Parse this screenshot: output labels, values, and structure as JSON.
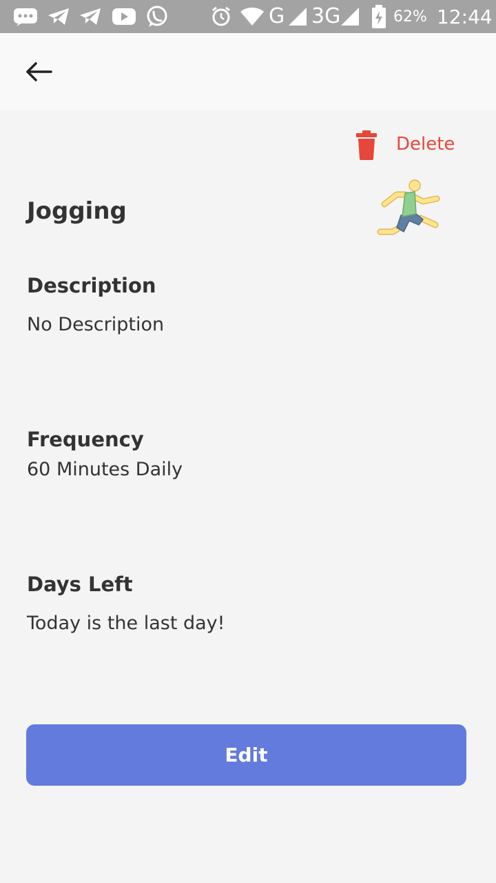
{
  "status_bar": {
    "signal_label": "G",
    "network_label": "3G",
    "battery": "62%",
    "time": "12:44",
    "icons": [
      "message-icon",
      "telegram-icon",
      "telegram-icon",
      "youtube-icon",
      "whatsapp-icon",
      "alarm-icon",
      "wifi-icon",
      "signal-icon",
      "signal-icon",
      "battery-icon"
    ]
  },
  "header": {
    "back_icon": "arrow-left-icon"
  },
  "actions": {
    "delete_label": "Delete",
    "delete_icon": "trash-icon",
    "delete_color": "#e7463a"
  },
  "activity": {
    "title": "Jogging",
    "icon": "running-person-icon"
  },
  "sections": {
    "description": {
      "heading": "Description",
      "value": "No Description"
    },
    "frequency": {
      "heading": "Frequency",
      "value": "60 Minutes Daily"
    },
    "days_left": {
      "heading": "Days Left",
      "value": "Today is the last day!"
    }
  },
  "footer": {
    "edit_label": "Edit",
    "accent_color": "#637bdc"
  }
}
